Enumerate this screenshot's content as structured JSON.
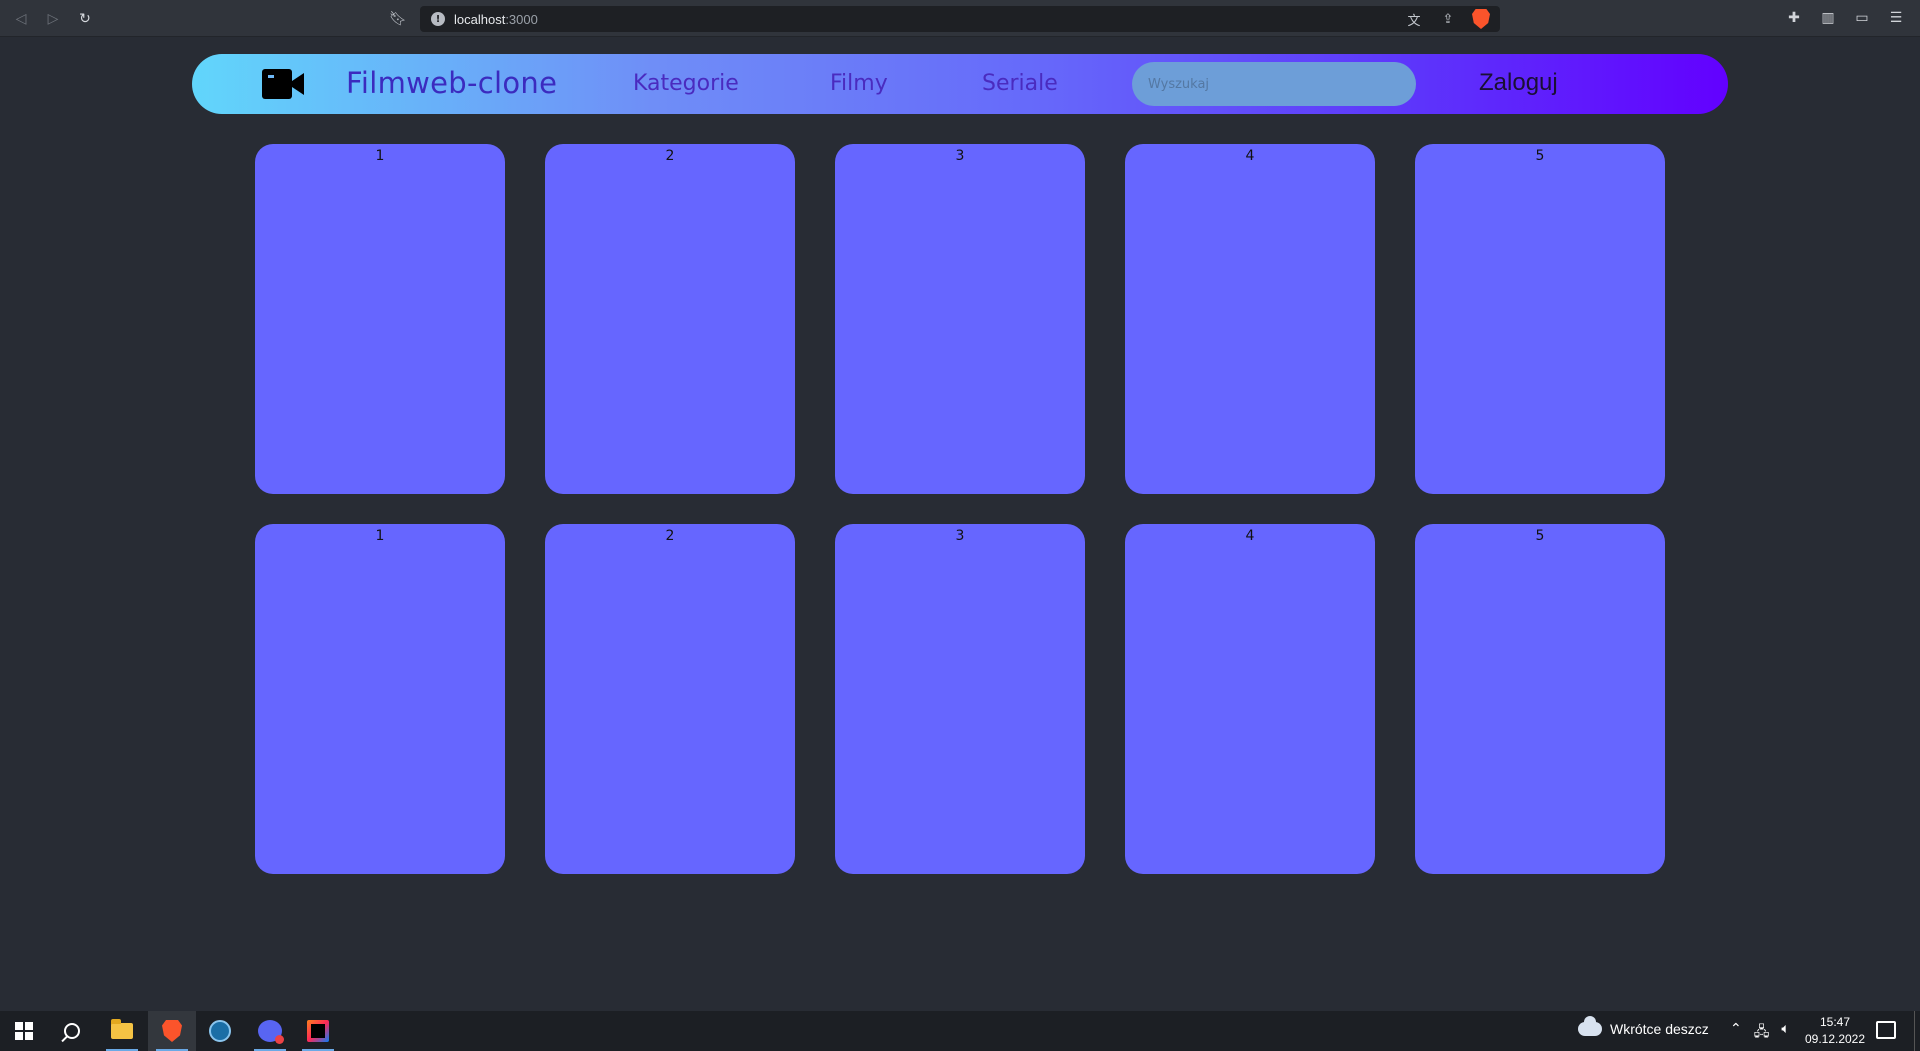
{
  "browser": {
    "url_host": "localhost",
    "url_port": ":3000"
  },
  "header": {
    "site_title": "Filmweb-clone",
    "nav": [
      "Kategorie",
      "Filmy",
      "Seriale"
    ],
    "search_placeholder": "Wyszukaj",
    "login_label": "Zaloguj",
    "colors": {
      "gradient_start": "#61d6fb",
      "gradient_end": "#6200ff",
      "link": "#4a2bbf",
      "card": "#6666ff",
      "page_bg": "#282c34"
    }
  },
  "grid": {
    "rows": [
      {
        "cards": [
          "1",
          "2",
          "3",
          "4",
          "5"
        ]
      },
      {
        "cards": [
          "1",
          "2",
          "3",
          "4",
          "5"
        ]
      }
    ]
  },
  "taskbar": {
    "apps": [
      "windows-start",
      "search",
      "file-explorer",
      "brave",
      "steam",
      "discord",
      "intellij-idea"
    ],
    "weather": "Wkrótce deszcz",
    "time": "15:47",
    "date": "09.12.2022"
  }
}
